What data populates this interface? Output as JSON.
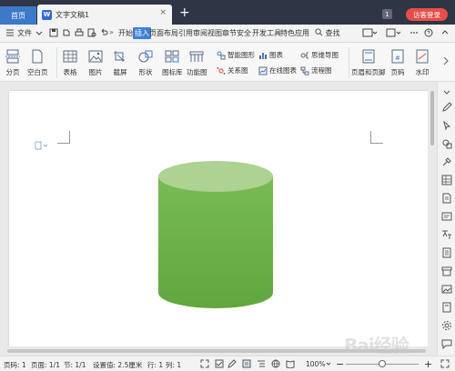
{
  "titlebar": {
    "home_tab": "首页",
    "doc_tab": "文字文稿1",
    "close": "×",
    "add_tab": "+",
    "badge": "1",
    "login": "访客登录"
  },
  "menubar": {
    "file": "文件",
    "more": "»",
    "items": [
      "开始",
      "插入",
      "页面布局",
      "引用",
      "审阅",
      "视图",
      "章节",
      "安全",
      "开发工具",
      "特色应用"
    ],
    "active": "插入",
    "search": "查找"
  },
  "ribbon": {
    "page_break": "分页",
    "blank_page": "空白页",
    "table": "表格",
    "picture": "图片",
    "screenshot": "截屏",
    "shape": "形状",
    "icon_library": "图标库",
    "function_chart": "功能图",
    "smart_art": "智能图形",
    "chart": "图表",
    "mind_map": "思维导图",
    "relation_map": "关系图",
    "online_chart": "在线图表",
    "flowchart": "流程图",
    "header_footer": "页眉和页脚",
    "page_number": "页码",
    "watermark": "水印"
  },
  "document": {
    "shape": "cylinder",
    "fill_top": "#aed291",
    "fill_body": "#6fb34d"
  },
  "statusbar": {
    "page_num": "页码: 1",
    "page": "页面: 1/1",
    "section": "节: 1/1",
    "setting": "设置值: 2.5厘米",
    "row": "行: 1",
    "col": "列: 1",
    "zoom": "100%",
    "minus": "−",
    "plus": "+"
  },
  "watermark_text": "Bai经验"
}
